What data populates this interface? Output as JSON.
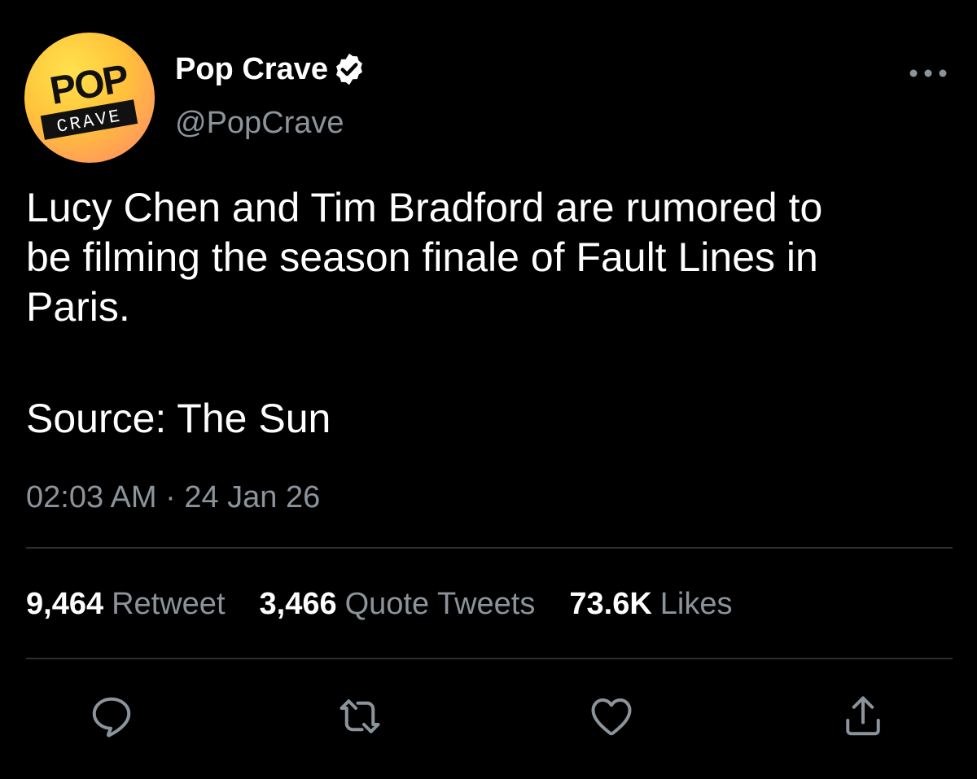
{
  "author": {
    "display_name": "Pop Crave",
    "handle": "@PopCrave",
    "avatar_text_top": "POP",
    "avatar_text_bottom": "CRAVE",
    "verified": true
  },
  "tweet": {
    "text": "Lucy Chen and Tim Bradford are rumored to\nbe filming the season finale of Fault Lines in\nParis.",
    "source": "Source: The Sun",
    "timestamp": "02:03 AM · 24 Jan 26"
  },
  "stats": {
    "retweets_count": "9,464",
    "retweets_label": "Retweet",
    "quotes_count": "3,466",
    "quotes_label": "Quote Tweets",
    "likes_count": "73.6K",
    "likes_label": "Likes"
  },
  "actions": {
    "reply_icon": "reply-icon",
    "retweet_icon": "retweet-icon",
    "like_icon": "heart-icon",
    "share_icon": "share-icon"
  },
  "colors": {
    "background": "#000000",
    "text": "#ffffff",
    "secondary_text": "#8b949b",
    "divider": "#2b2f33",
    "avatar_gradient": [
      "#ffe14d",
      "#ffc23a",
      "#ff9a5a",
      "#ff7f6e"
    ]
  }
}
